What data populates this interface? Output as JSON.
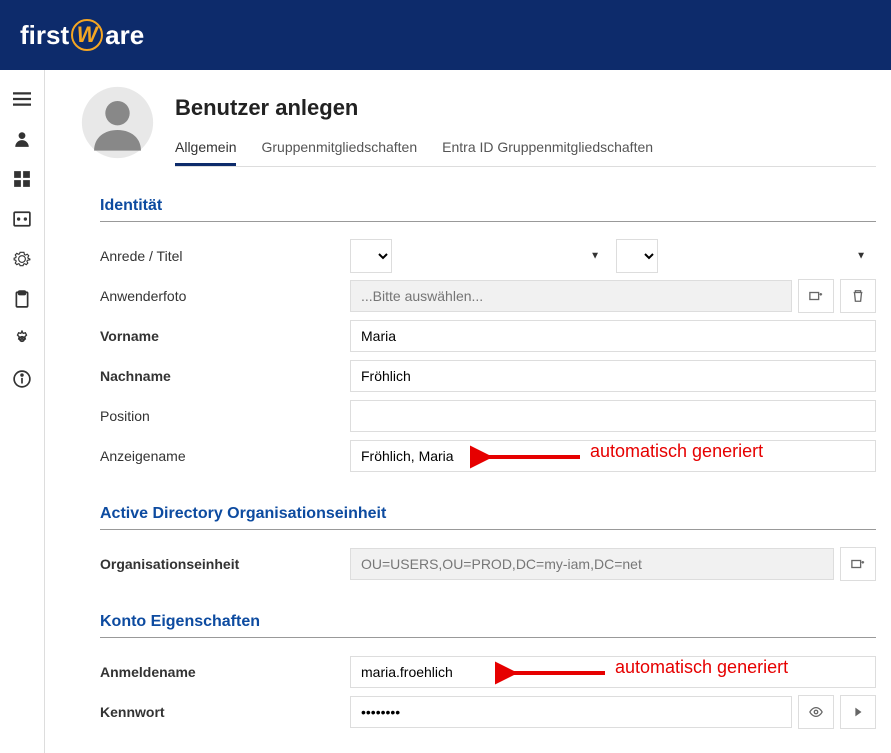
{
  "logo": {
    "prefix": "first",
    "letter": "W",
    "suffix": "are"
  },
  "page": {
    "title": "Benutzer anlegen"
  },
  "tabs": [
    {
      "label": "Allgemein",
      "active": true
    },
    {
      "label": "Gruppenmitgliedschaften",
      "active": false
    },
    {
      "label": "Entra ID Gruppenmitgliedschaften",
      "active": false
    }
  ],
  "sections": {
    "identity": {
      "title": "Identität",
      "salutation_label": "Anrede / Titel",
      "photo_label": "Anwenderfoto",
      "photo_placeholder": "...Bitte auswählen...",
      "firstname_label": "Vorname",
      "firstname_value": "Maria",
      "lastname_label": "Nachname",
      "lastname_value": "Fröhlich",
      "position_label": "Position",
      "position_value": "",
      "displayname_label": "Anzeigename",
      "displayname_value": "Fröhlich, Maria"
    },
    "ou": {
      "title": "Active Directory Organisationseinheit",
      "ou_label": "Organisationseinheit",
      "ou_value": "OU=USERS,OU=PROD,DC=my-iam,DC=net"
    },
    "account": {
      "title": "Konto Eigenschaften",
      "login_label": "Anmeldename",
      "login_value": "maria.froehlich",
      "password_label": "Kennwort",
      "password_value": "••••••••"
    }
  },
  "annotations": {
    "auto1": "automatisch generiert",
    "auto2": "automatisch generiert"
  }
}
